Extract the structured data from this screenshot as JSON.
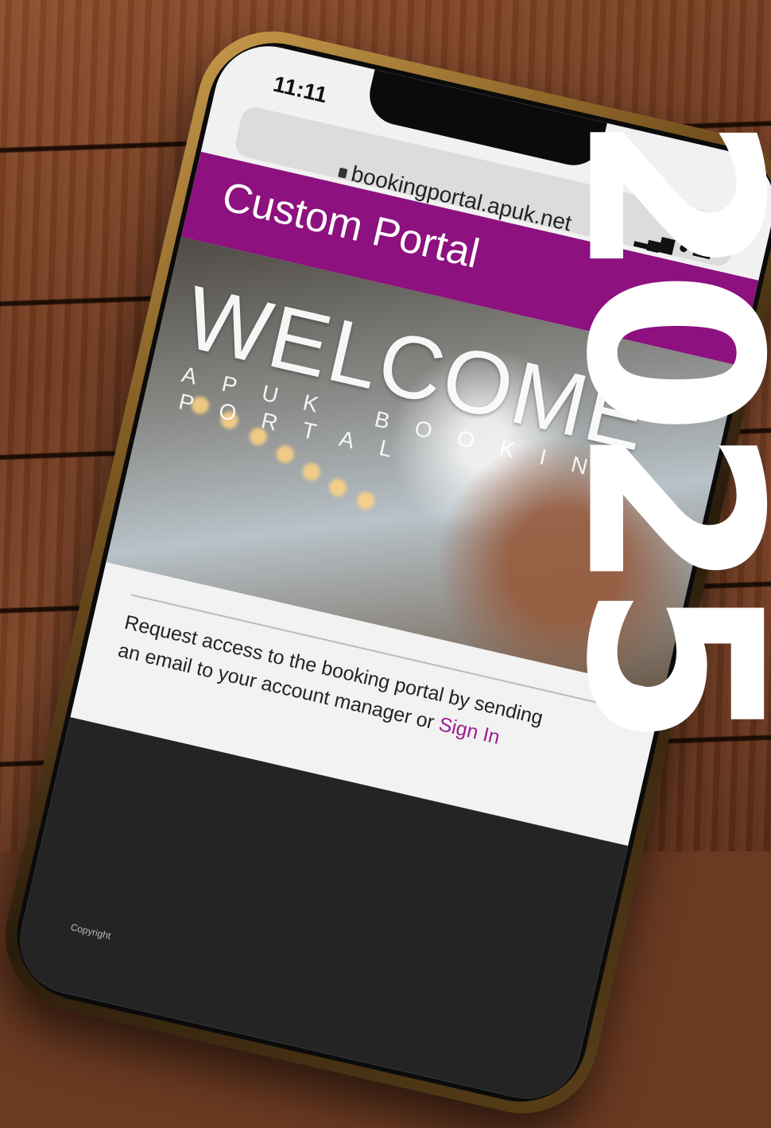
{
  "phone": {
    "time": "11:11",
    "url": "bookingportal.apuk.net",
    "status_icons": "▂▄▆ ● ▬"
  },
  "portal": {
    "title": "Custom Portal",
    "welcome": "WELCOME",
    "subtitle_line1": "APUK BOOKING",
    "subtitle_line2": "PORTAL"
  },
  "request": {
    "text": "Request access to the booking portal by sending an email to your account manager or ",
    "signin_label": "Sign In"
  },
  "footer": {
    "text": "Copyright"
  },
  "overlay": {
    "year": "2025"
  },
  "colors": {
    "portal_purple": "#8d117f",
    "link_purple": "#9c1e8e",
    "year_text": "#ffffff"
  }
}
